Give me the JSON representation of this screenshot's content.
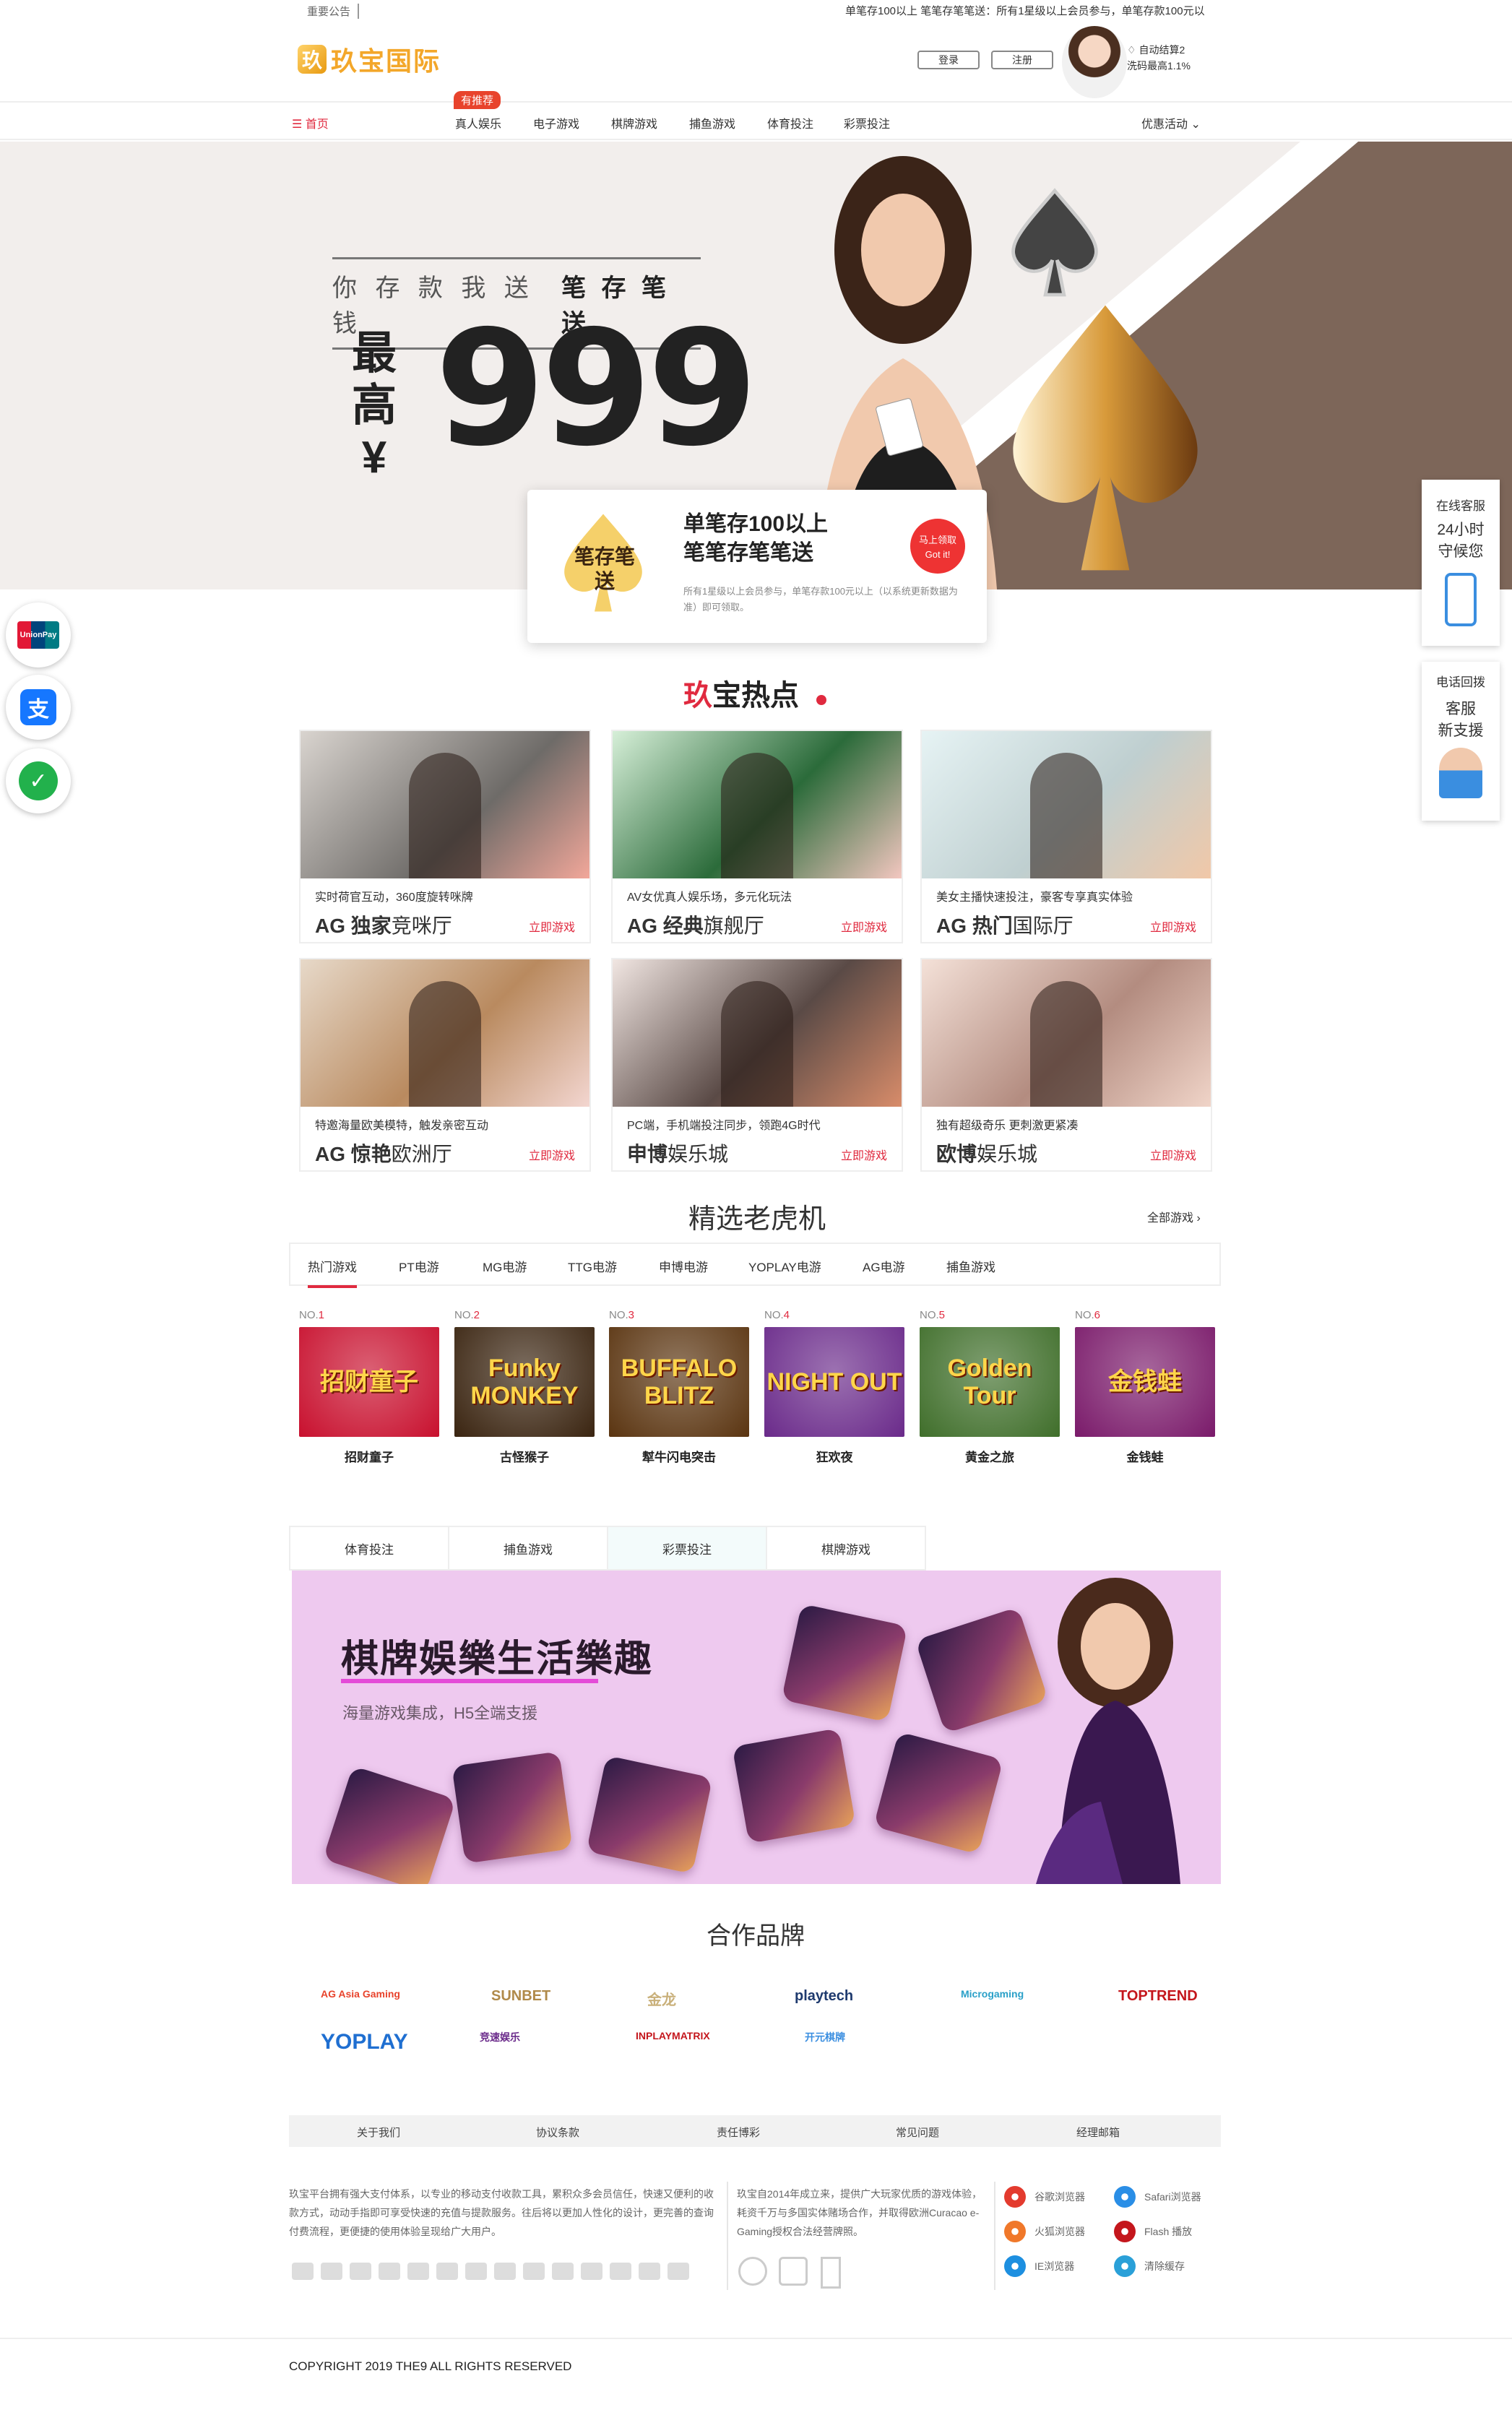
{
  "topbar": {
    "notice_label": "重要公告",
    "marquee": "单笔存100以上 笔笔存笔笔送：所有1星级以上会员参与，单笔存款100元以"
  },
  "header": {
    "logo_text": "玖宝国际",
    "logo_mark": "玖",
    "login_label": "登录",
    "register_label": "注册",
    "side_line1": "自动结算2",
    "side_line2": "洗码最高1.1%"
  },
  "nav": {
    "home": "首页",
    "badge": "有推荐",
    "items": [
      "真人娱乐",
      "电子游戏",
      "棋牌游戏",
      "捕鱼游戏",
      "体育投注",
      "彩票投注"
    ],
    "promo": "优惠活动"
  },
  "banner": {
    "line1_left": "你 存 款 我 送 钱",
    "line1_right": "笔 存 笔 送",
    "max": "最高",
    "currency": "¥",
    "amount": "999"
  },
  "promo_card": {
    "badge_text": "笔存笔送",
    "title1": "单笔存100以上",
    "title2": "笔笔存笔笔送",
    "desc": "所有1星级以上会员参与，单笔存款100元以上（以系统更新数据为准）即可领取。",
    "btn_line1": "马上领取",
    "btn_line2": "Got it!"
  },
  "left_floats": [
    "UnionPay",
    "支付宝",
    "微信"
  ],
  "right_floats": {
    "service": {
      "title": "在线客服",
      "l1": "24小时",
      "l2": "守候您"
    },
    "callback": {
      "title": "电话回拨",
      "l1": "客服",
      "l2": "新支援"
    }
  },
  "hot": {
    "title_red": "玖",
    "title_rest": "宝热点",
    "cards": [
      {
        "desc": "实时荷官互动，360度旋转咪牌",
        "brand": "AG",
        "bold": "独家",
        "rest": "竞咪厅",
        "go": "立即游戏"
      },
      {
        "desc": "AV女优真人娱乐场，多元化玩法",
        "brand": "AG",
        "bold": "经典",
        "rest": "旗舰厅",
        "go": "立即游戏"
      },
      {
        "desc": "美女主播快速投注，豪客专享真实体验",
        "brand": "AG",
        "bold": "热门",
        "rest": "国际厅",
        "go": "立即游戏"
      },
      {
        "desc": "特邀海量欧美模特，触发亲密互动",
        "brand": "AG",
        "bold": "惊艳",
        "rest": "欧洲厅",
        "go": "立即游戏"
      },
      {
        "desc": "PC端，手机端投注同步，领跑4G时代",
        "brand": "",
        "bold": "申博",
        "rest": "娱乐城",
        "go": "立即游戏"
      },
      {
        "desc": "独有超级奇乐 更刺激更紧凑",
        "brand": "",
        "bold": "欧博",
        "rest": "娱乐城",
        "go": "立即游戏"
      }
    ]
  },
  "slots": {
    "title": "精选老虎机",
    "all_label": "全部游戏 ›",
    "tabs": [
      "热门游戏",
      "PT电游",
      "MG电游",
      "TTG电游",
      "申博电游",
      "YOPLAY电游",
      "AG电游",
      "捕鱼游戏"
    ],
    "games": [
      {
        "no": "NO.",
        "rank": "1",
        "name": "招财童子",
        "art": "招财童子",
        "bg": "#c8102e"
      },
      {
        "no": "NO.",
        "rank": "2",
        "name": "古怪猴子",
        "art": "Funky MONKEY",
        "bg": "#3a2410"
      },
      {
        "no": "NO.",
        "rank": "3",
        "name": "犎牛闪电突击",
        "art": "BUFFALO BLITZ",
        "bg": "#5a3410"
      },
      {
        "no": "NO.",
        "rank": "4",
        "name": "狂欢夜",
        "art": "NIGHT OUT",
        "bg": "#6a2a8a"
      },
      {
        "no": "NO.",
        "rank": "5",
        "name": "黄金之旅",
        "art": "Golden Tour",
        "bg": "#3f6e2a"
      },
      {
        "no": "NO.",
        "rank": "6",
        "name": "金钱蛙",
        "art": "金钱蛙",
        "bg": "#7a1a6a"
      }
    ]
  },
  "categories": {
    "tabs": [
      "体育投注",
      "捕鱼游戏",
      "彩票投注",
      "棋牌游戏"
    ],
    "banner_title": "棋牌娛樂生活樂趣",
    "banner_sub": "海量游戏集成，H5全端支援"
  },
  "partners": {
    "title": "合作品牌",
    "row1": [
      "AG Asia Gaming",
      "SUNBET",
      "金龙",
      "playtech",
      "Microgaming",
      "TOPTREND"
    ],
    "row2": [
      "YOPLAY",
      "竞速娱乐",
      "INPLAYMATRIX",
      "开元棋牌"
    ]
  },
  "footer": {
    "links": [
      "关于我们",
      "协议条款",
      "责任博彩",
      "常见问题",
      "经理邮箱"
    ],
    "left_text": "玖宝平台拥有强大支付体系，以专业的移动支付收款工具，累积众多会员信任，快速又便利的收款方式，动动手指即可享受快速的充值与提款服务。往后将以更加人性化的设计，更完善的查询付费流程，更便捷的使用体验呈现给广大用户。",
    "mid_text": "玖宝自2014年成立来，提供广大玩家优质的游戏体验，耗资千万与多国实体赌场合作，并取得欧洲Curacao e-Gaming授权合法经营牌照。",
    "browsers": [
      {
        "name": "谷歌浏览器",
        "color": "#e33b2e"
      },
      {
        "name": "Safari浏览器",
        "color": "#2a8ee6"
      },
      {
        "name": "火狐浏览器",
        "color": "#f0782a"
      },
      {
        "name": "Flash 播放",
        "color": "#c4161c"
      },
      {
        "name": "IE浏览器",
        "color": "#1d8fe0"
      },
      {
        "name": "清除缓存",
        "color": "#2aa0d8"
      }
    ],
    "copyright": "COPYRIGHT 2019 THE9 ALL RIGHTS RESERVED"
  },
  "colors": {
    "accent": "#e02a3f",
    "brown": "#7d6659",
    "gold": "#f3a72a"
  }
}
